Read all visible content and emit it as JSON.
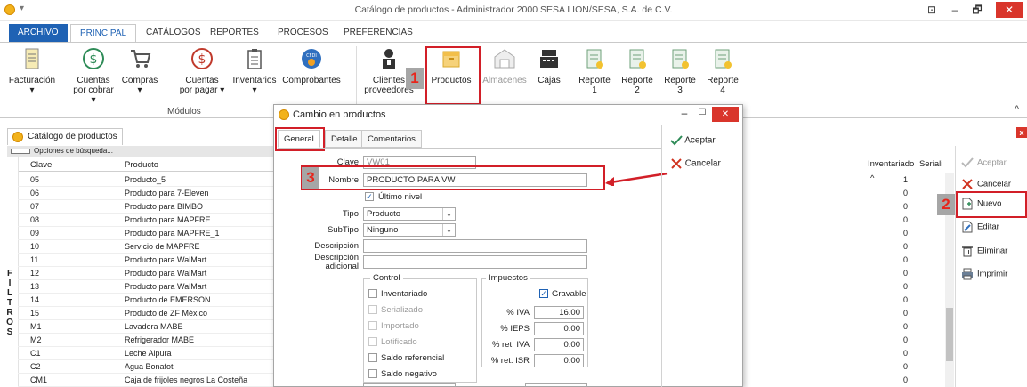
{
  "window": {
    "title": "Catálogo de productos - Administrador 2000 SESA LION/SESA, S.A. de C.V.",
    "controls": [
      "⊡",
      "–",
      "🗗",
      "✕"
    ]
  },
  "ribbon": {
    "tabs": [
      "ARCHIVO",
      "PRINCIPAL",
      "CATÁLOGOS",
      "REPORTES",
      "PROCESOS",
      "PREFERENCIAS"
    ],
    "buttons": [
      {
        "label": "Facturación",
        "sub": "▾",
        "icon": "invoice-icon"
      },
      {
        "label": "Cuentas",
        "sub": "por cobrar ▾",
        "icon": "dollar-circle-icon"
      },
      {
        "label": "Compras",
        "sub": "▾",
        "icon": "cart-icon"
      },
      {
        "label": "Cuentas",
        "sub": "por pagar ▾",
        "icon": "dollar-red-circle-icon"
      },
      {
        "label": "Inventarios",
        "sub": "▾",
        "icon": "clipboard-icon"
      },
      {
        "label": "Comprobantes",
        "sub": "",
        "icon": "cfdi-icon"
      },
      {
        "label": "Clientes",
        "sub": "proveedores",
        "icon": "people-icon"
      },
      {
        "label": "Productos",
        "sub": "",
        "icon": "box-icon"
      },
      {
        "label": "Almacenes",
        "sub": "",
        "icon": "warehouse-icon"
      },
      {
        "label": "Cajas",
        "sub": "",
        "icon": "register-icon"
      },
      {
        "label": "Reporte",
        "sub": "1",
        "icon": "report-icon"
      },
      {
        "label": "Reporte",
        "sub": "2",
        "icon": "report-icon"
      },
      {
        "label": "Reporte",
        "sub": "3",
        "icon": "report-icon"
      },
      {
        "label": "Reporte",
        "sub": "4",
        "icon": "report-icon"
      }
    ],
    "group_label": "Módulos",
    "collapse": "^"
  },
  "annotations": {
    "n1": "1",
    "n2": "2",
    "n3": "3"
  },
  "document": {
    "tab_label": "Catálogo de productos",
    "tab_close": "✕",
    "filter_label": "Opciones de búsqueda...",
    "side_filters": [
      "F",
      "I",
      "L",
      "T",
      "R",
      "O",
      "S"
    ],
    "columns": {
      "clave": "Clave",
      "producto": "Producto",
      "inventariado": "Inventariado",
      "seriali": "Seriali",
      "sort": "^"
    },
    "rows": [
      {
        "clave": "05",
        "producto": "Producto_5",
        "inv": "1"
      },
      {
        "clave": "06",
        "producto": "Producto para 7-Eleven",
        "inv": "0"
      },
      {
        "clave": "07",
        "producto": "Producto para BIMBO",
        "inv": "0"
      },
      {
        "clave": "08",
        "producto": "Producto para MAPFRE",
        "inv": "0"
      },
      {
        "clave": "09",
        "producto": "Producto para MAPFRE_1",
        "inv": "0"
      },
      {
        "clave": "10",
        "producto": "Servicio de MAPFRE",
        "inv": "0"
      },
      {
        "clave": "11",
        "producto": "Producto para WalMart",
        "inv": "0"
      },
      {
        "clave": "12",
        "producto": "Producto para WalMart",
        "inv": "0"
      },
      {
        "clave": "13",
        "producto": "Producto para WalMart",
        "inv": "0"
      },
      {
        "clave": "14",
        "producto": "Producto de EMERSON",
        "inv": "0"
      },
      {
        "clave": "15",
        "producto": "Producto de ZF México",
        "inv": "0"
      },
      {
        "clave": "M1",
        "producto": "Lavadora MABE",
        "inv": "0"
      },
      {
        "clave": "M2",
        "producto": "Refrigerador MABE",
        "inv": "0"
      },
      {
        "clave": "C1",
        "producto": "Leche Alpura",
        "inv": "0"
      },
      {
        "clave": "C2",
        "producto": "Agua Bonafot",
        "inv": "0"
      },
      {
        "clave": "CM1",
        "producto": "Caja de frijoles negros La Costeña",
        "inv": "0"
      }
    ]
  },
  "right_actions": {
    "aceptar": "Aceptar",
    "cancelar": "Cancelar",
    "nuevo": "Nuevo",
    "editar": "Editar",
    "eliminar": "Eliminar",
    "imprimir": "Imprimir",
    "close_x": "x"
  },
  "dialog": {
    "title": "Cambio en productos",
    "controls": [
      "–",
      "☐",
      "✕"
    ],
    "tabs": [
      "General",
      "Detalle",
      "Comentarios"
    ],
    "fields": {
      "clave_label": "Clave",
      "clave_value": "VW01",
      "nombre_label": "Nombre",
      "nombre_value": "PRODUCTO PARA VW",
      "ultimo_nivel": "Último nivel",
      "tipo_label": "Tipo",
      "tipo_value": "Producto",
      "subtipo_label": "SubTipo",
      "subtipo_value": "Ninguno",
      "descripcion_label": "Descripción",
      "desc_adic_label_1": "Descripción",
      "desc_adic_label_2": "adicional"
    },
    "control": {
      "title": "Control",
      "items": [
        {
          "label": "Inventariado",
          "checked": false,
          "disabled": false
        },
        {
          "label": "Serializado",
          "checked": false,
          "disabled": true
        },
        {
          "label": "Importado",
          "checked": false,
          "disabled": true
        },
        {
          "label": "Lotificado",
          "checked": false,
          "disabled": true
        },
        {
          "label": "Saldo referencial",
          "checked": false,
          "disabled": false
        },
        {
          "label": "Saldo negativo",
          "checked": false,
          "disabled": false
        }
      ]
    },
    "impuestos": {
      "title": "Impuestos",
      "gravable": "Gravable",
      "rows": [
        {
          "label": "% IVA",
          "value": "16.00"
        },
        {
          "label": "% IEPS",
          "value": "0.00"
        },
        {
          "label": "% ret. IVA",
          "value": "0.00"
        },
        {
          "label": "% ret. ISR",
          "value": "0.00"
        }
      ]
    },
    "actions": {
      "aceptar": "Aceptar",
      "cancelar": "Cancelar"
    }
  }
}
